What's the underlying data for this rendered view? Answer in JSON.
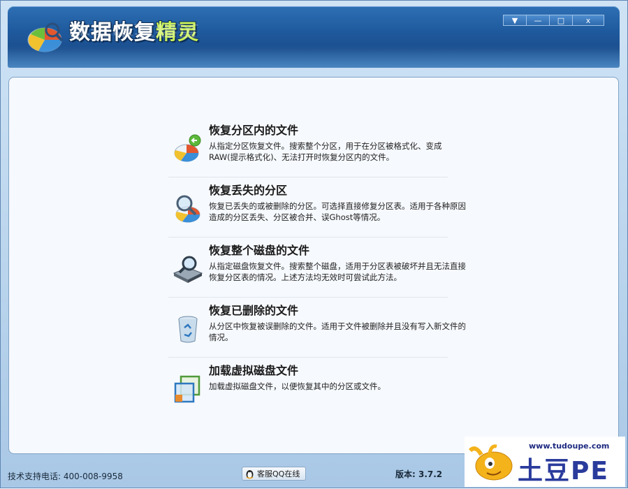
{
  "window": {
    "title_main": "数据恢复",
    "title_accent": "精灵",
    "controls": {
      "menu_icon": "▼",
      "minimize_icon": "—",
      "maximize_icon": "□",
      "close_icon": "x"
    }
  },
  "options": [
    {
      "title": "恢复分区内的文件",
      "description": "从指定分区恢复文件。搜索整个分区，用于在分区被格式化、变成RAW(提示格式化)、无法打开时恢复分区内的文件。",
      "icon": "pie-chart-arrow-icon"
    },
    {
      "title": "恢复丢失的分区",
      "description": "恢复已丢失的或被删除的分区。可选择直接修复分区表。适用于各种原因造成的分区丢失、分区被合并、误Ghost等情况。",
      "icon": "magnifier-pie-icon"
    },
    {
      "title": "恢复整个磁盘的文件",
      "description": "从指定磁盘恢复文件。搜索整个磁盘，适用于分区表被破坏并且无法直接恢复分区表的情况。上述方法均无效时可尝试此方法。",
      "icon": "hard-disk-magnifier-icon"
    },
    {
      "title": "恢复已删除的文件",
      "description": "从分区中恢复被误删除的文件。适用于文件被删除并且没有写入新文件的情况。",
      "icon": "recycle-bin-icon"
    },
    {
      "title": "加载虚拟磁盘文件",
      "description": "加载虚拟磁盘文件，以便恢复其中的分区或文件。",
      "icon": "virtual-disk-icon"
    }
  ],
  "statusbar": {
    "support_phone": "技术支持电话: 400-008-9958",
    "qq_button_label": "客服QQ在线",
    "version": "版本: 3.7.2"
  },
  "watermark": {
    "url": "www.tudoupe.com",
    "brand": "土豆PE"
  }
}
